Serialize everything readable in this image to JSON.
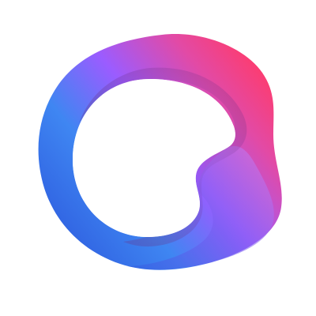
{
  "logo": {
    "icon": "gradient-ring-logo-icon",
    "colors": {
      "violet": "#9b5cff",
      "blue": "#3f86f2",
      "deep_blue": "#2f5fe0",
      "magenta": "#e24aa6",
      "pink_red": "#ff3b6b",
      "lavender": "#c57cf2",
      "shadow_purple": "#6a2f86",
      "background": "#ffffff"
    }
  }
}
